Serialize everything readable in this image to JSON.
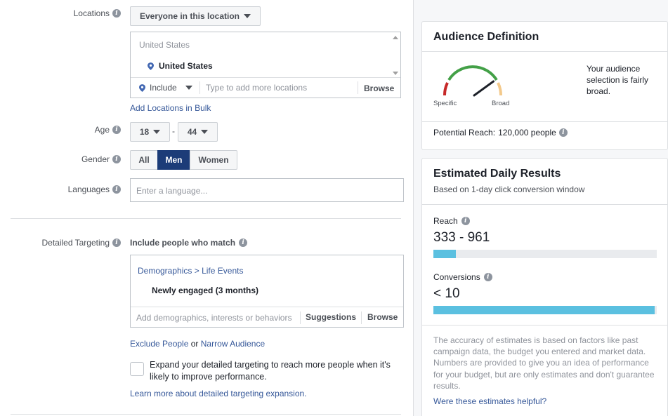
{
  "locations": {
    "label": "Locations",
    "type_dropdown": "Everyone in this location",
    "header": "United States",
    "selected": "United States",
    "include_label": "Include",
    "input_placeholder": "Type to add more locations",
    "browse": "Browse",
    "bulk_link": "Add Locations in Bulk"
  },
  "age": {
    "label": "Age",
    "min": "18",
    "separator": "-",
    "max": "44"
  },
  "gender": {
    "label": "Gender",
    "options": [
      "All",
      "Men",
      "Women"
    ],
    "selected": "Men"
  },
  "languages": {
    "label": "Languages",
    "placeholder": "Enter a language..."
  },
  "detailed_targeting": {
    "label": "Detailed Targeting",
    "include_text": "Include people who match",
    "breadcrumb_a": "Demographics",
    "breadcrumb_sep": ">",
    "breadcrumb_b": "Life Events",
    "item": "Newly engaged (3 months)",
    "input_placeholder": "Add demographics, interests or behaviors",
    "suggestions": "Suggestions",
    "browse": "Browse",
    "exclude_link": "Exclude People",
    "or_text": "or",
    "narrow_link": "Narrow Audience",
    "expand_text_1": "Expand your detailed targeting to reach more people when it's",
    "expand_text_2": "likely to improve performance.",
    "learn_more": "Learn more about detailed targeting expansion."
  },
  "audience_definition": {
    "title": "Audience Definition",
    "gauge_left": "Specific",
    "gauge_right": "Broad",
    "gauge_level": 0.8,
    "description_1": "Your audience",
    "description_2": "selection is fairly",
    "description_3": "broad.",
    "reach_label": "Potential Reach:",
    "reach_value": "120,000 people"
  },
  "estimated_results": {
    "title": "Estimated Daily Results",
    "subtitle": "Based on 1-day click conversion window",
    "reach_label": "Reach",
    "reach_value": "333 - 961",
    "reach_fill": 0.1,
    "conversions_label": "Conversions",
    "conversions_value": "< 10",
    "conversions_fill": 0.99,
    "disclaimer_1": "The accuracy of estimates is based on factors like past",
    "disclaimer_2": "campaign data, the budget you entered and market data.",
    "disclaimer_3": "Numbers are provided to give you an idea of performance",
    "disclaimer_4": "for your budget, but are only estimates and don't guarantee",
    "disclaimer_5": "results.",
    "helpful_link": "Were these estimates helpful?"
  },
  "colors": {
    "accent": "#1c3c78",
    "link": "#365899",
    "bar": "#5bc0e0",
    "bar_bg": "#e9ebee"
  }
}
